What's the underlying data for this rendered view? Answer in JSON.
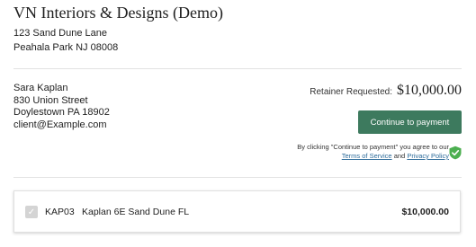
{
  "company": {
    "name": "VN Interiors & Designs (Demo)",
    "address_line1": "123 Sand Dune Lane",
    "address_line2": "Peahala Park NJ 08008"
  },
  "client": {
    "name": "Sara Kaplan",
    "street": "830 Union Street",
    "city": "Doylestown PA 18902",
    "email": "client@Example.com"
  },
  "retainer": {
    "label": "Retainer Requested:",
    "amount": "$10,000.00"
  },
  "pay_button": {
    "label": "Continue to payment"
  },
  "agreement": {
    "text": "By clicking \"Continue to payment\" you agree to our",
    "terms_link": "Terms of Service",
    "and": "and",
    "privacy_link": "Privacy Policy"
  },
  "line_item": {
    "code": "KAP03",
    "description": "Kaplan 6E Sand Dune FL",
    "amount": "$10,000.00",
    "checked": true
  },
  "colors": {
    "accent": "#3d7a5e",
    "shield": "#4caf50",
    "link": "#2d6b9a"
  },
  "icons": {
    "shield": "shield-check-icon",
    "checkbox": "check-icon"
  }
}
